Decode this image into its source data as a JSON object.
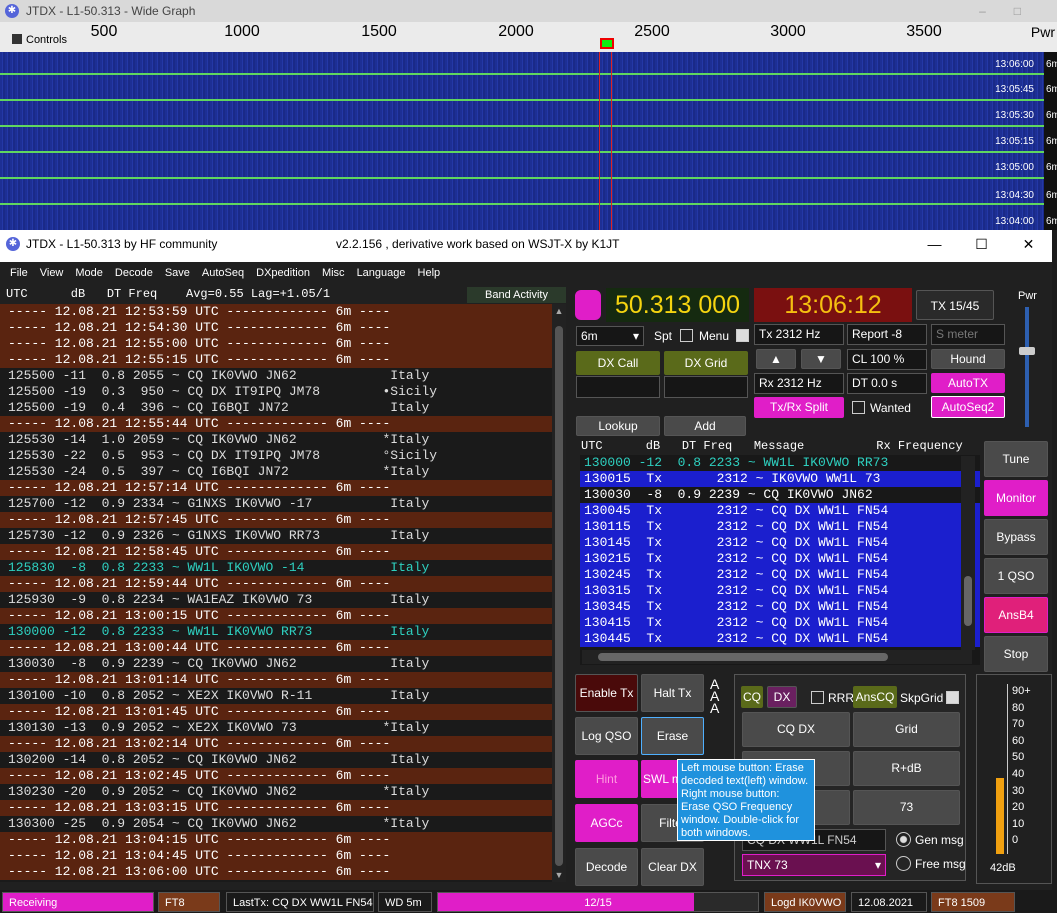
{
  "widegraph": {
    "title": "JTDX - L1-50.313 - Wide Graph",
    "controls_label": "Controls",
    "pwr_label": "Pwr",
    "scale_ticks": [
      "500",
      "1000",
      "1500",
      "2000",
      "2500",
      "3000",
      "3500"
    ],
    "time_labels": [
      "13:06:00",
      "13:05:45",
      "13:05:30",
      "13:05:15",
      "13:05:00",
      "13:04:30",
      "13:04:00"
    ],
    "band_labels": [
      "6m",
      "6m",
      "6m",
      "6m",
      "6m",
      "6m",
      "6m"
    ]
  },
  "main": {
    "title": "JTDX - L1-50.313  by HF community",
    "subtitle": "v2.2.156 , derivative work based on WSJT-X by K1JT",
    "menu": [
      "File",
      "View",
      "Mode",
      "Decode",
      "Save",
      "AutoSeq",
      "DXpedition",
      "Misc",
      "Language",
      "Help"
    ],
    "left_header": "UTC      dB   DT Freq    Avg=0.55 Lag=+1.05/1",
    "band_activity": "Band Activity",
    "left_rows": [
      {
        "t": "----- 12.08.21 12:53:59 UTC ------------- 6m ----",
        "k": "sep"
      },
      {
        "t": "----- 12.08.21 12:54:30 UTC ------------- 6m ----",
        "k": "sep"
      },
      {
        "t": "----- 12.08.21 12:55:00 UTC ------------- 6m ----",
        "k": "sep"
      },
      {
        "t": "----- 12.08.21 12:55:15 UTC ------------- 6m ----",
        "k": "sep"
      },
      {
        "t": "125500 -11  0.8 2055 ~ CQ IK0VWO JN62            Italy",
        "k": ""
      },
      {
        "t": "125500 -19  0.3  950 ~ CQ DX IT9IPQ JM78        •Sicily",
        "k": ""
      },
      {
        "t": "125500 -19  0.4  396 ~ CQ I6BQI JN72             Italy",
        "k": ""
      },
      {
        "t": "----- 12.08.21 12:55:44 UTC ------------- 6m ----",
        "k": "sep"
      },
      {
        "t": "125530 -14  1.0 2059 ~ CQ IK0VWO JN62           *Italy",
        "k": ""
      },
      {
        "t": "125530 -22  0.5  953 ~ CQ DX IT9IPQ JM78        °Sicily",
        "k": ""
      },
      {
        "t": "125530 -24  0.5  397 ~ CQ I6BQI JN72            *Italy",
        "k": ""
      },
      {
        "t": "----- 12.08.21 12:57:14 UTC ------------- 6m ----",
        "k": "sep"
      },
      {
        "t": "125700 -12  0.9 2334 ~ G1NXS IK0VWO -17          Italy",
        "k": ""
      },
      {
        "t": "----- 12.08.21 12:57:45 UTC ------------- 6m ----",
        "k": "sep"
      },
      {
        "t": "125730 -12  0.9 2326 ~ G1NXS IK0VWO RR73         Italy",
        "k": ""
      },
      {
        "t": "----- 12.08.21 12:58:45 UTC ------------- 6m ----",
        "k": "sep"
      },
      {
        "t": "125830  -8  0.8 2233 ~ WW1L IK0VWO -14           Italy",
        "k": "cyan"
      },
      {
        "t": "----- 12.08.21 12:59:44 UTC ------------- 6m ----",
        "k": "sep"
      },
      {
        "t": "125930  -9  0.8 2234 ~ WA1EAZ IK0VWO 73          Italy",
        "k": ""
      },
      {
        "t": "----- 12.08.21 13:00:15 UTC ------------- 6m ----",
        "k": "sep"
      },
      {
        "t": "130000 -12  0.8 2233 ~ WW1L IK0VWO RR73          Italy",
        "k": "cyan"
      },
      {
        "t": "----- 12.08.21 13:00:44 UTC ------------- 6m ----",
        "k": "sep"
      },
      {
        "t": "130030  -8  0.9 2239 ~ CQ IK0VWO JN62            Italy",
        "k": ""
      },
      {
        "t": "----- 12.08.21 13:01:14 UTC ------------- 6m ----",
        "k": "sep"
      },
      {
        "t": "130100 -10  0.8 2052 ~ XE2X IK0VWO R-11          Italy",
        "k": ""
      },
      {
        "t": "----- 12.08.21 13:01:45 UTC ------------- 6m ----",
        "k": "sep"
      },
      {
        "t": "130130 -13  0.9 2052 ~ XE2X IK0VWO 73           *Italy",
        "k": ""
      },
      {
        "t": "----- 12.08.21 13:02:14 UTC ------------- 6m ----",
        "k": "sep"
      },
      {
        "t": "130200 -14  0.8 2052 ~ CQ IK0VWO JN62            Italy",
        "k": ""
      },
      {
        "t": "----- 12.08.21 13:02:45 UTC ------------- 6m ----",
        "k": "sep"
      },
      {
        "t": "130230 -20  0.9 2052 ~ CQ IK0VWO JN62           *Italy",
        "k": ""
      },
      {
        "t": "----- 12.08.21 13:03:15 UTC ------------- 6m ----",
        "k": "sep"
      },
      {
        "t": "130300 -25  0.9 2054 ~ CQ IK0VWO JN62           *Italy",
        "k": ""
      },
      {
        "t": "----- 12.08.21 13:04:15 UTC ------------- 6m ----",
        "k": "sep"
      },
      {
        "t": "----- 12.08.21 13:04:45 UTC ------------- 6m ----",
        "k": "sep"
      },
      {
        "t": "----- 12.08.21 13:06:00 UTC ------------- 6m ----",
        "k": "sep"
      }
    ],
    "frequency": "50.313 000",
    "clock": "13:06:12",
    "tx_period": "TX 15/45",
    "band": "6m",
    "spt_label": "Spt",
    "menu_label": "Menu",
    "tx_hz": "Tx  2312 Hz",
    "rx_hz": "Rx  2312 Hz",
    "report": "Report -8",
    "smeter_placeholder": "S meter",
    "cl": "CL  100 %",
    "dt": "DT 0.0 s",
    "hound": "Hound",
    "autotx": "AutoTX",
    "autoseq2": "AutoSeq2",
    "wanted": "Wanted",
    "txrx_split": "Tx/Rx Split",
    "dx_call": "DX Call",
    "dx_grid": "DX Grid",
    "lookup": "Lookup",
    "add": "Add",
    "qso_header": "UTC      dB   DT Freq   Message          Rx Frequency",
    "qso_rows": [
      {
        "t": "130000 -12  0.8 2233 ~ WW1L IK0VWO RR73",
        "k": "cyan"
      },
      {
        "t": "130015  Tx       2312 ~ IK0VWO WW1L 73",
        "k": "sel"
      },
      {
        "t": "130030  -8  0.9 2239 ~ CQ IK0VWO JN62",
        "k": ""
      },
      {
        "t": "130045  Tx       2312 ~ CQ DX WW1L FN54",
        "k": "sel"
      },
      {
        "t": "130115  Tx       2312 ~ CQ DX WW1L FN54",
        "k": "sel"
      },
      {
        "t": "130145  Tx       2312 ~ CQ DX WW1L FN54",
        "k": "sel"
      },
      {
        "t": "130215  Tx       2312 ~ CQ DX WW1L FN54",
        "k": "sel"
      },
      {
        "t": "130245  Tx       2312 ~ CQ DX WW1L FN54",
        "k": "sel"
      },
      {
        "t": "130315  Tx       2312 ~ CQ DX WW1L FN54",
        "k": "sel"
      },
      {
        "t": "130345  Tx       2312 ~ CQ DX WW1L FN54",
        "k": "sel"
      },
      {
        "t": "130415  Tx       2312 ~ CQ DX WW1L FN54",
        "k": "sel"
      },
      {
        "t": "130445  Tx       2312 ~ CQ DX WW1L FN54",
        "k": "sel"
      }
    ],
    "side_buttons": [
      "Tune",
      "Monitor",
      "Bypass",
      "1 QSO",
      "AnsB4",
      "Stop"
    ],
    "enable_tx": "Enable Tx",
    "halt_tx": "Halt Tx",
    "log_qso": "Log QSO",
    "erase": "Erase",
    "hint": "Hint",
    "swl_mode": "SWL mode",
    "agcc": "AGCc",
    "filter": "Filter",
    "decode": "Decode",
    "clear_dx": "Clear DX",
    "cq": "CQ",
    "dx": "DX",
    "rrr": "RRR",
    "anscq": "AnsCQ",
    "skipgrid": "SkpGrid",
    "cq_dx": "CQ DX",
    "grid": "Grid",
    "r_db": "R+dB",
    "n73": "73",
    "gen_msg_field": "CQ DX WW1L FN54",
    "tnx_select": "TNX 73",
    "gen_msg": "Gen msg",
    "free_msg": "Free msg",
    "tooltip": "Left mouse button: Erase decoded text(left) window. Right mouse button: Erase QSO Frequency window. Double-click for both windows.",
    "meter_ticks": [
      "90+",
      "80",
      "70",
      "60",
      "50",
      "40",
      "30",
      "20",
      "10",
      "0"
    ],
    "meter_db": "42dB",
    "pwr": "Pwr",
    "meter_level": 0.42
  },
  "status": {
    "receiving": "Receiving",
    "mode": "FT8",
    "lasttx": "LastTx: CQ DX WW1L FN54",
    "wd": "WD 5m",
    "progress": "12/15",
    "progress_fraction": 0.8,
    "logd": "Logd IK0VWO",
    "date": "12.08.2021",
    "ft8num": "FT8  1509"
  },
  "colors": {
    "magenta": "#e01ec8",
    "olive": "#5a6a1a",
    "select": "#1b1fce"
  }
}
